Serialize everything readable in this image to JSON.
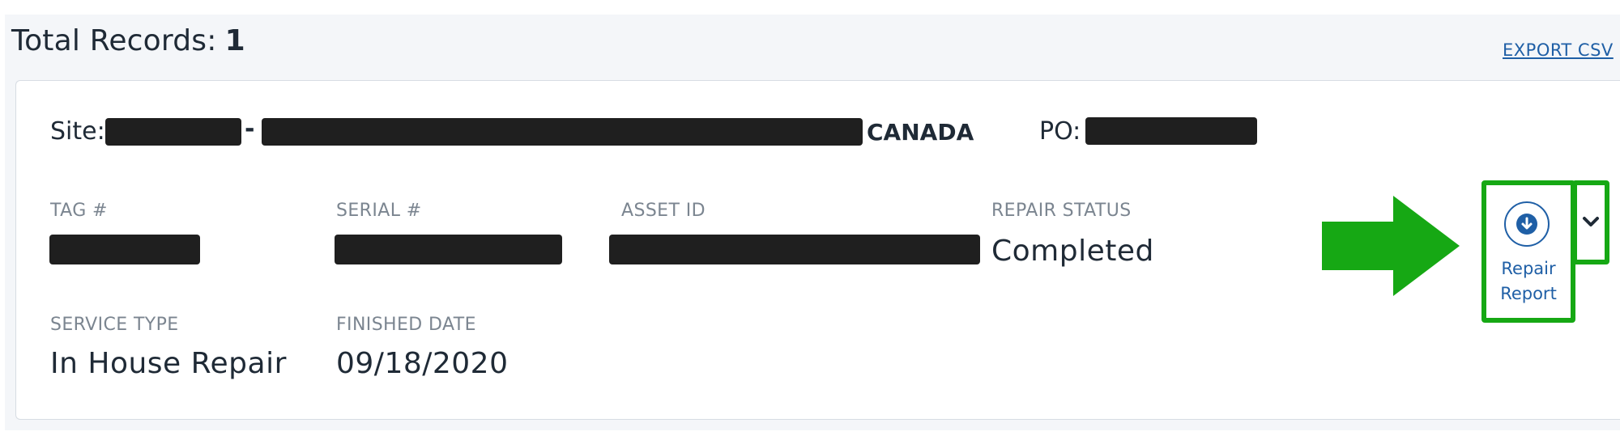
{
  "header": {
    "total_label": "Total Records:",
    "total_count": "1",
    "export_label": "EXPORT CSV"
  },
  "record": {
    "site_label": "Site:",
    "site_separator": "-",
    "site_country": "CANADA",
    "po_label": "PO:",
    "fields": {
      "tag_label": "TAG #",
      "serial_label": "SERIAL #",
      "asset_label": "ASSET ID",
      "repair_status_label": "REPAIR STATUS",
      "repair_status_value": "Completed",
      "service_type_label": "SERVICE TYPE",
      "service_type_value": "In House Repair",
      "finished_date_label": "FINISHED DATE",
      "finished_date_value": "09/18/2020"
    },
    "actions": {
      "report_label_line1": "Repair",
      "report_label_line2": "Report",
      "report_icon": "download-circle-icon",
      "expand_icon": "chevron-down-icon"
    }
  },
  "colors": {
    "highlight": "#16a814",
    "link": "#1f5fa6",
    "redaction": "#1f1f1f"
  }
}
